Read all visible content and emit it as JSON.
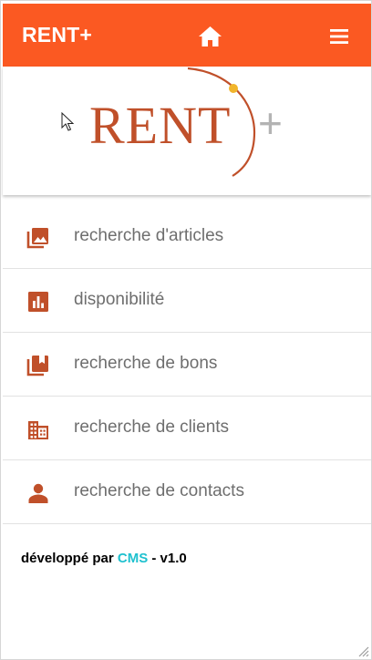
{
  "header": {
    "brand": "RENT+",
    "icons": [
      "home-icon",
      "hamburger-menu-icon"
    ],
    "background": "#fb5922"
  },
  "logo": {
    "word": "RENT",
    "plus": "+",
    "word_color": "#c0502a",
    "plus_color": "#b3b3b3",
    "dot_color": "#f1b52c"
  },
  "menu": {
    "items": [
      {
        "label": "recherche d'articles",
        "icon": "image-icon"
      },
      {
        "label": "disponibilité",
        "icon": "bar-chart-icon"
      },
      {
        "label": "recherche de bons",
        "icon": "bookmark-stack-icon"
      },
      {
        "label": "recherche de clients",
        "icon": "building-icon"
      },
      {
        "label": "recherche de contacts",
        "icon": "person-icon"
      }
    ],
    "icon_color": "#c0502a"
  },
  "footer": {
    "prefix": "développé par ",
    "company": "CMS",
    "suffix": " - v1.0",
    "company_color": "#1fc1cf"
  }
}
